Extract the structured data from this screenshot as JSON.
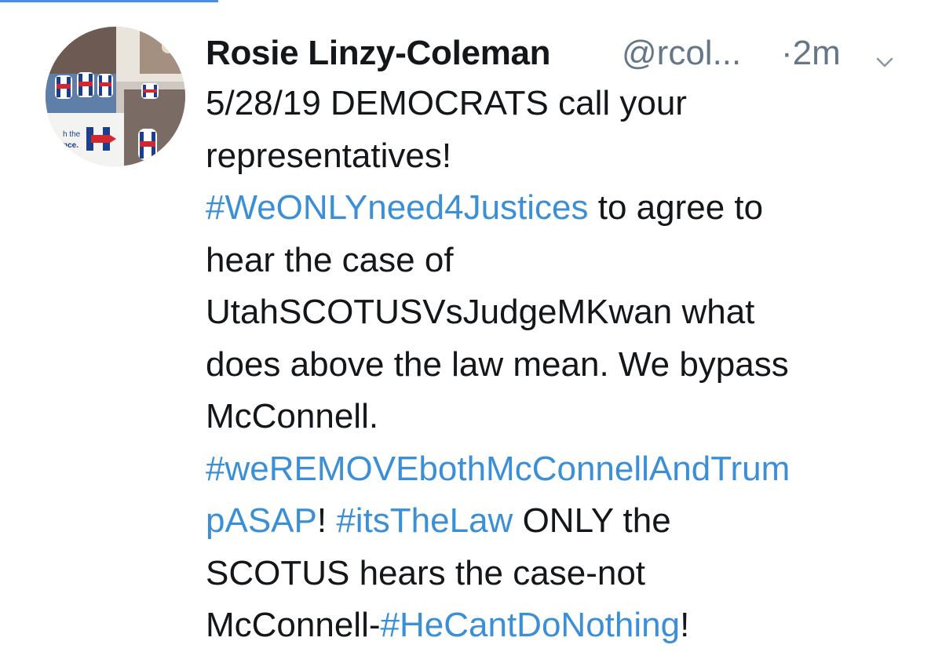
{
  "tweet": {
    "display_name": "Rosie Linzy-Coleman",
    "handle": "@rcol...",
    "separator": "·",
    "time": "2m",
    "avatar_text_1": "h the",
    "avatar_text_2": "nce.",
    "lines": [
      [
        {
          "text": "5/28/19 DEMOCRATS call your",
          "type": "text"
        }
      ],
      [
        {
          "text": "representatives!",
          "type": "text"
        }
      ],
      [
        {
          "text": "#WeONLYneed4Justices",
          "type": "hashtag"
        },
        {
          "text": " to agree to",
          "type": "text"
        }
      ],
      [
        {
          "text": "hear the case of",
          "type": "text"
        }
      ],
      [
        {
          "text": "UtahSCOTUSVsJudgeMKwan what",
          "type": "text"
        }
      ],
      [
        {
          "text": "does above the law mean. We bypass",
          "type": "text"
        }
      ],
      [
        {
          "text": "McConnell.",
          "type": "text"
        }
      ],
      [
        {
          "text": "#weREMOVEbothMcConnellAndTrum",
          "type": "hashtag"
        }
      ],
      [
        {
          "text": "pASAP",
          "type": "hashtag"
        },
        {
          "text": "! ",
          "type": "text"
        },
        {
          "text": "#itsTheLaw",
          "type": "hashtag"
        },
        {
          "text": "  ONLY the",
          "type": "text"
        }
      ],
      [
        {
          "text": "SCOTUS hears the case-not",
          "type": "text"
        }
      ],
      [
        {
          "text": "McConnell-",
          "type": "text"
        },
        {
          "text": "#HeCantDoNothing",
          "type": "hashtag"
        },
        {
          "text": "!",
          "type": "text"
        }
      ]
    ]
  },
  "colors": {
    "hashtag": "#3b8fd6",
    "text": "#14171a",
    "meta": "#657786",
    "accent": "#4a90e2"
  },
  "icons": {
    "more": "chevron-down-icon"
  }
}
